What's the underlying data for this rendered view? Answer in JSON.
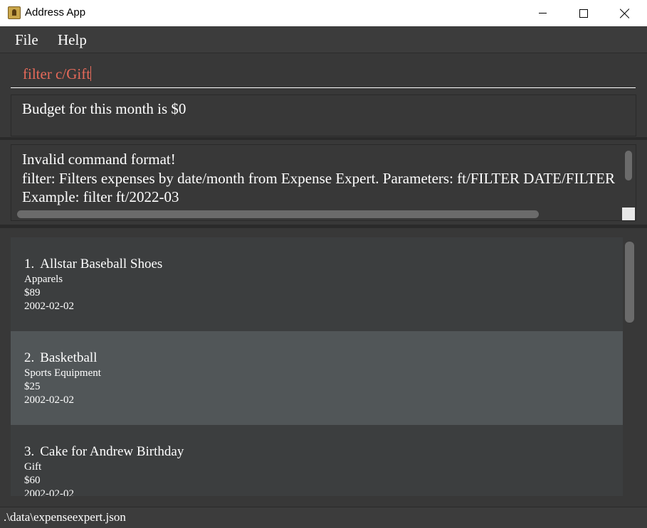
{
  "window": {
    "title": "Address App"
  },
  "menu": {
    "items": [
      "File",
      "Help"
    ]
  },
  "command": {
    "value": "filter c/Gift"
  },
  "budget": {
    "text": "Budget for this month is $0"
  },
  "result": {
    "lines": [
      "Invalid command format!",
      "filter: Filters expenses by date/month from Expense Expert. Parameters: ft/FILTER DATE/FILTER",
      "Example: filter ft/2022-03"
    ]
  },
  "expenses": [
    {
      "index": "1.",
      "name": "Allstar Baseball Shoes",
      "category": "Apparels",
      "amount": "$89",
      "date": "2002-02-02"
    },
    {
      "index": "2.",
      "name": "Basketball",
      "category": "Sports Equipment",
      "amount": "$25",
      "date": "2002-02-02"
    },
    {
      "index": "3.",
      "name": "Cake for Andrew Birthday",
      "category": "Gift",
      "amount": "$60",
      "date": "2002-02-02"
    }
  ],
  "status": {
    "path": ".\\data\\expenseexpert.json"
  }
}
